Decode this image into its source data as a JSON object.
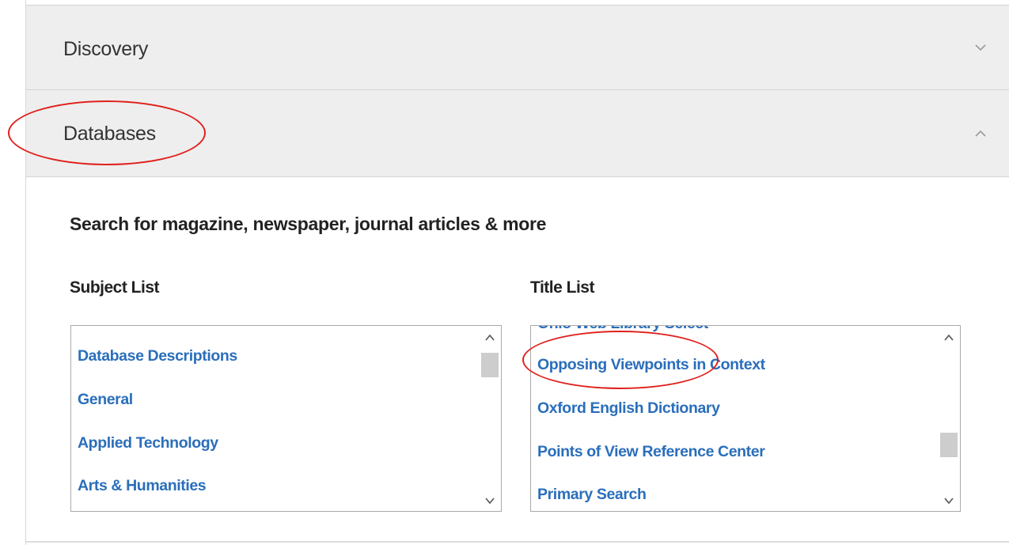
{
  "accordion": {
    "sections": [
      {
        "title": "Discovery",
        "state": "collapsed",
        "chevron_icon": "chevron-down-icon"
      },
      {
        "title": "Databases",
        "state": "expanded",
        "chevron_icon": "chevron-up-icon"
      }
    ]
  },
  "databases_panel": {
    "heading": "Search for magazine, newspaper, journal articles & more",
    "subject_list": {
      "label": "Subject List",
      "items": [
        "Database Descriptions",
        "General",
        "Applied Technology",
        "Arts & Humanities"
      ]
    },
    "title_list": {
      "label": "Title List",
      "partial_item": "Ohio Web Library Select",
      "items": [
        "Opposing Viewpoints in Context",
        "Oxford English Dictionary",
        "Points of View Reference Center",
        "Primary Search"
      ]
    }
  },
  "colors": {
    "header_bg": "#eeeeee",
    "link": "#2a6ebb",
    "annotation": "#e0201c"
  }
}
